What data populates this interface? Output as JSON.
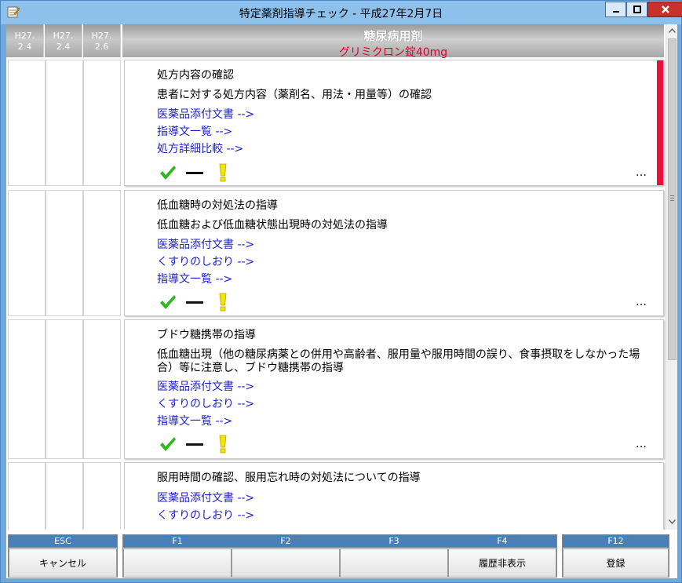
{
  "window": {
    "title": "特定薬剤指導チェック - 平成27年2月7日",
    "minimize_label": "_",
    "maximize_label": "□",
    "close_label": "×"
  },
  "header": {
    "dates": [
      {
        "era": "H27.",
        "day": "2.4"
      },
      {
        "era": "H27.",
        "day": "2.4"
      },
      {
        "era": "H27.",
        "day": "2.6"
      }
    ],
    "category": "糖尿病用剤",
    "drug": "グリミクロン錠40mg"
  },
  "cards": [
    {
      "title": "処方内容の確認",
      "description": "患者に対する処方内容（薬剤名、用法・用量等）の確認",
      "links": [
        "医薬品添付文書 -->",
        "指導文一覧 -->",
        "処方詳細比較 -->"
      ],
      "more_label": "…",
      "flagged": true
    },
    {
      "title": "低血糖時の対処法の指導",
      "description": "低血糖および低血糖状態出現時の対処法の指導",
      "links": [
        "医薬品添付文書 -->",
        "くすりのしおり -->",
        "指導文一覧 -->"
      ],
      "more_label": "…",
      "flagged": false
    },
    {
      "title": "ブドウ糖携帯の指導",
      "description": "低血糖出現（他の糖尿病薬との併用や高齢者、服用量や服用時間の誤り、食事摂取をしなかった場合）等に注意し、ブドウ糖携帯の指導",
      "links": [
        "医薬品添付文書 -->",
        "くすりのしおり -->",
        "指導文一覧 -->"
      ],
      "more_label": "…",
      "flagged": false
    },
    {
      "title": "服用時間の確認、服用忘れ時の対処法についての指導",
      "links": [
        "医薬品添付文書 -->",
        "くすりのしおり -->"
      ]
    }
  ],
  "action_icons": [
    "check-icon",
    "dash-icon",
    "exclamation-icon"
  ],
  "colors": {
    "accent_red": "#e8103c",
    "link_blue": "#1f22c8",
    "check_green": "#2fb81e",
    "warning_yellow": "#f2e600",
    "fkey_bar": "#4a80b8"
  },
  "function_keys": {
    "esc": {
      "key": "ESC",
      "label": "キャンセル"
    },
    "f1": {
      "key": "F1",
      "label": ""
    },
    "f2": {
      "key": "F2",
      "label": ""
    },
    "f3": {
      "key": "F3",
      "label": ""
    },
    "f4": {
      "key": "F4",
      "label": "履歴非表示"
    },
    "f12": {
      "key": "F12",
      "label": "登録"
    }
  }
}
